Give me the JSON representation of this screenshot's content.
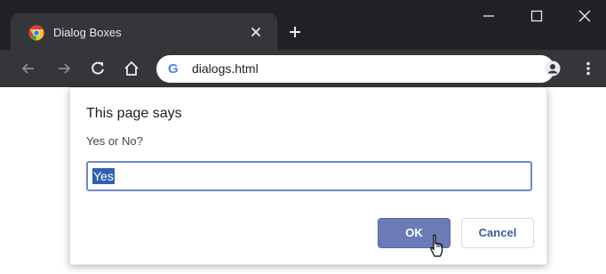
{
  "browser": {
    "tab": {
      "title": "Dialog Boxes",
      "favicon": "chrome-logo-icon"
    },
    "new_tab_icon": "plus-icon",
    "window_controls": [
      "minimize-icon",
      "maximize-icon",
      "close-icon"
    ],
    "toolbar": {
      "icons": [
        "back-arrow-icon",
        "forward-arrow-icon",
        "reload-icon",
        "home-icon",
        "profile-icon",
        "menu-dots-icon"
      ],
      "omnibox_url": "dialogs.html",
      "omnibox_badge": "G"
    },
    "colors": {
      "frame": "#202124",
      "toolbar": "#35363a"
    }
  },
  "dialog": {
    "title": "This page says",
    "message": "Yes or No?",
    "input_value": "Yes",
    "ok_label": "OK",
    "cancel_label": "Cancel",
    "colors": {
      "ok_button": "#6a7bb8",
      "input_border": "#6f88c7",
      "selection": "#2f62b4"
    }
  }
}
